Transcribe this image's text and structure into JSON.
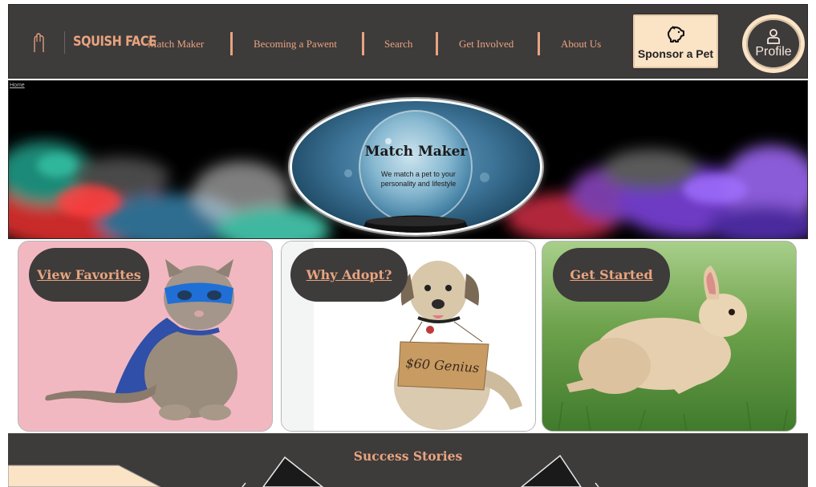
{
  "brand": {
    "name": "SQUISH FACE",
    "accent": "#e8a47f",
    "nav_bg": "#3e3b3b",
    "cream": "#fbe3c6"
  },
  "nav": {
    "links": [
      "Match Maker",
      "Becoming a Pawent",
      "Search",
      "Get Involved",
      "About Us"
    ]
  },
  "sponsor": {
    "label": "Sponsor a Pet",
    "icon": "piggy-bank-icon"
  },
  "profile": {
    "label": "Profile",
    "icon": "person-icon"
  },
  "breadcrumb": {
    "home": "Home"
  },
  "hero": {
    "title": "Match Maker",
    "subtitle": "We match a pet to your personality and lifestyle"
  },
  "cards": [
    {
      "label": "View Favorites",
      "image": "cat-in-superhero-mask"
    },
    {
      "label": "Why Adopt?",
      "image": "dog-with-sign"
    },
    {
      "label": "Get Started",
      "image": "bunny-on-grass"
    }
  ],
  "dog_sign": "$60 Genius",
  "success": {
    "title": "Success Stories"
  }
}
